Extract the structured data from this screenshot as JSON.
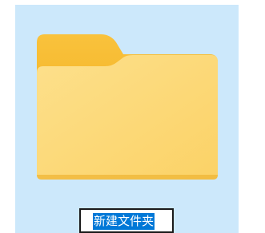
{
  "item": {
    "icon": "folder-icon",
    "name_value": "新建文件夹",
    "state": "renaming"
  },
  "colors": {
    "selection_background": "#cce8fb",
    "text_selection": "#0078d7",
    "folder_front": "#fcd86a",
    "folder_back": "#f4b830"
  }
}
